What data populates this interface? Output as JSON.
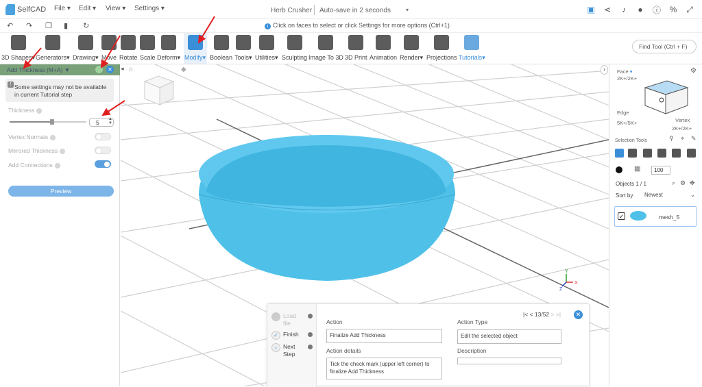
{
  "app": {
    "name": "SelfCAD"
  },
  "menus": [
    "File",
    "Edit",
    "View",
    "Settings"
  ],
  "document": {
    "title": "Herb Crusher",
    "autosave": "Auto-save in 2 seconds"
  },
  "hint": "Click on faces to select or click Settings for more options (Ctrl+1)",
  "toolbar": {
    "tools": [
      "3D Shapes",
      "Generators",
      "Drawing",
      "Move",
      "Rotate",
      "Scale",
      "Deform",
      "Modify",
      "Boolean",
      "Tools",
      "Utilities",
      "Sculpting",
      "Image To 3D",
      "3D Print",
      "Animation",
      "Render",
      "Projections",
      "Tutorials"
    ],
    "active_tool": "Modify",
    "find_tool": "Find Tool (Ctrl + F)"
  },
  "left_panel": {
    "title": "Add Thickness (M+A)",
    "warning": "Some settings may not be available in current Tutorial step",
    "thickness_label": "Thickness",
    "thickness_value": "5",
    "vertex_normals": {
      "label": "Vertex Normals",
      "on": false
    },
    "mirrored_thickness": {
      "label": "Mirrored Thickness",
      "on": false
    },
    "add_connections": {
      "label": "Add Connections",
      "on": true
    },
    "preview_label": "Preview"
  },
  "right_panel": {
    "face_label": "Face",
    "face_shortcut": "2K+/2K+",
    "edge_label": "Edge",
    "edge_shortcut": "5K+/5K+",
    "vertex_label": "Vertex",
    "vertex_shortcut": "2K+/2K+",
    "selection_tools": "Selection Tools",
    "opacity": "100",
    "objects_count": "Objects 1 / 1",
    "sort_by": "Sort by",
    "sort_value": "Newest",
    "object_name": "mesh_5"
  },
  "tutorial": {
    "steps": [
      "Load file",
      "Finish",
      "Next Step"
    ],
    "action_label": "Action",
    "action_value": "Finalize Add Thickness",
    "action_details_label": "Action details",
    "action_details": "Tick the check mark (upper left corner) to finalize Add Thickness",
    "action_type_label": "Action Type",
    "action_type_value": "Edit the selected object",
    "description_label": "Description",
    "description_value": "",
    "page": "13/52"
  },
  "axes": {
    "x": "X",
    "y": "Y",
    "z": "Z"
  },
  "colors": {
    "accent": "#3b8fd8",
    "object": "#4fc1e9",
    "panel_header": "#7aa17a",
    "annotation_arrow": "#e02020"
  }
}
